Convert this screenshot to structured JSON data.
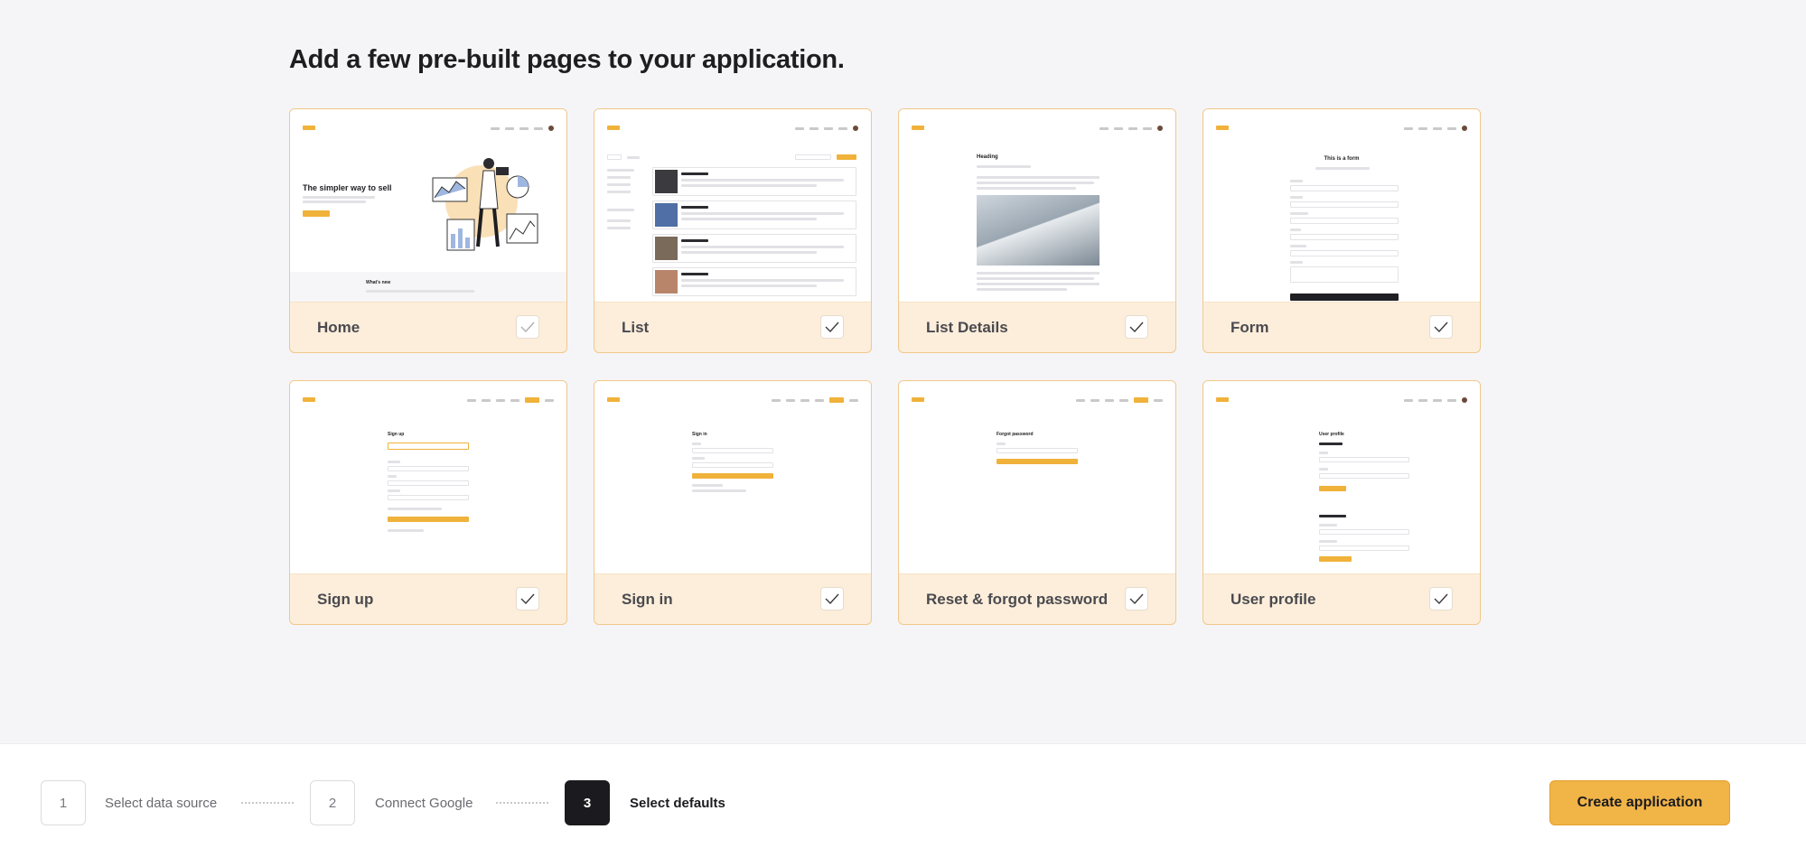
{
  "page": {
    "title": "Add a few pre-built pages to your application."
  },
  "pages": [
    {
      "label": "Home",
      "checked": true,
      "check_faded": true,
      "preview_heading": "The simpler way to sell",
      "preview_subheading": "What's new"
    },
    {
      "label": "List",
      "checked": true
    },
    {
      "label": "List Details",
      "checked": true,
      "preview_heading": "Heading"
    },
    {
      "label": "Form",
      "checked": true,
      "preview_heading": "This is a form"
    },
    {
      "label": "Sign up",
      "checked": true,
      "preview_heading": "Sign up"
    },
    {
      "label": "Sign in",
      "checked": true,
      "preview_heading": "Sign in"
    },
    {
      "label": "Reset & forgot password",
      "checked": true,
      "preview_heading": "Forgot password"
    },
    {
      "label": "User profile",
      "checked": true,
      "preview_heading": "User profile"
    }
  ],
  "stepper": {
    "steps": [
      {
        "number": "1",
        "label": "Select data source",
        "active": false
      },
      {
        "number": "2",
        "label": "Connect Google",
        "active": false
      },
      {
        "number": "3",
        "label": "Select defaults",
        "active": true
      }
    ]
  },
  "actions": {
    "create_label": "Create application"
  },
  "colors": {
    "accent": "#f1b447",
    "card_bg": "#fdeedb",
    "card_border": "#f0c88c",
    "active_step": "#1b1b1f"
  },
  "icons": {
    "check": "checkmark-icon"
  }
}
